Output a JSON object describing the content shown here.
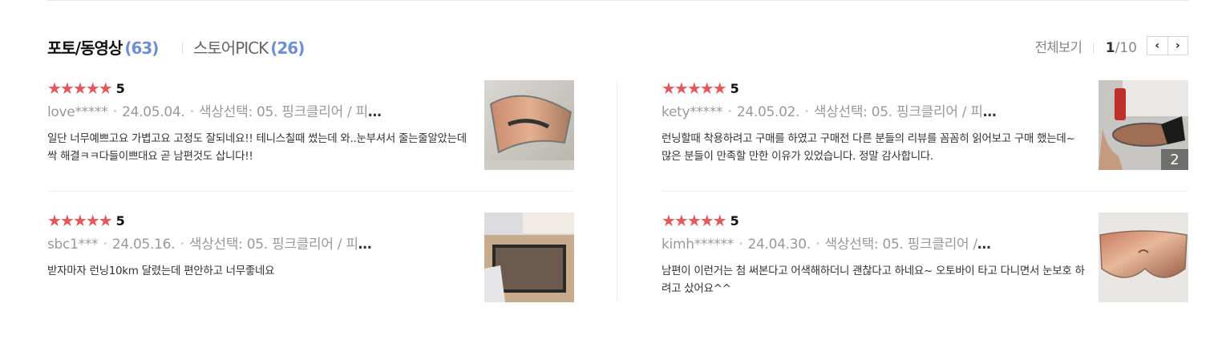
{
  "header": {
    "tabs": [
      {
        "label": "포토/동영상",
        "count": "(63)"
      },
      {
        "label": "스토어PICK",
        "count": "(26)"
      }
    ],
    "view_all": "전체보기",
    "page_current": "1",
    "page_total": "/10",
    "prev_glyph": "‹",
    "next_glyph": "›"
  },
  "reviews": [
    {
      "stars": "★★★★★",
      "score": "5",
      "user": "love*****",
      "date": "24.05.04.",
      "option": "색상선택: 05. 핑크클리어 / 피",
      "text": "일단 너무예쁘고요 가볍고요 고정도 잘되네요!! 테니스칠때 썼는데 와..눈부셔서 줄는줄알았는데 싹 해결ㅋㅋ다들이쁘대요 곧 남편것도 삽니다!!"
    },
    {
      "stars": "★★★★★",
      "score": "5",
      "user": "kety*****",
      "date": "24.05.02.",
      "option": "색상선택: 05. 핑크클리어 / 피",
      "text": "런닝할때 착용하려고 구매를 하였고 구매전 다른 분들의 리뷰를 꼼꼼히 읽어보고 구매 했는데~ 많은 분들이 만족할 만한 이유가 있었습니다. 정말 감사합니다.",
      "image_count": "2"
    },
    {
      "stars": "★★★★★",
      "score": "5",
      "user": "sbc1***",
      "date": "24.05.16.",
      "option": "색상선택: 05. 핑크클리어 / 피",
      "text": "받자마자 런닝10km 달렸는데 편안하고 너무좋네요"
    },
    {
      "stars": "★★★★★",
      "score": "5",
      "user": "kimh******",
      "date": "24.04.30.",
      "option": "색상선택: 05. 핑크클리어 /",
      "text": "남편이 이런거는 첨 써본다고 어색해하더니 괜찮다고 하네요~ 오토바이 타고 다니면서 눈보호 하려고 샀어요^^"
    }
  ],
  "ellipsis": "…",
  "colors": {
    "star": "#e05a5a",
    "count_accent": "#6e8fd0"
  }
}
